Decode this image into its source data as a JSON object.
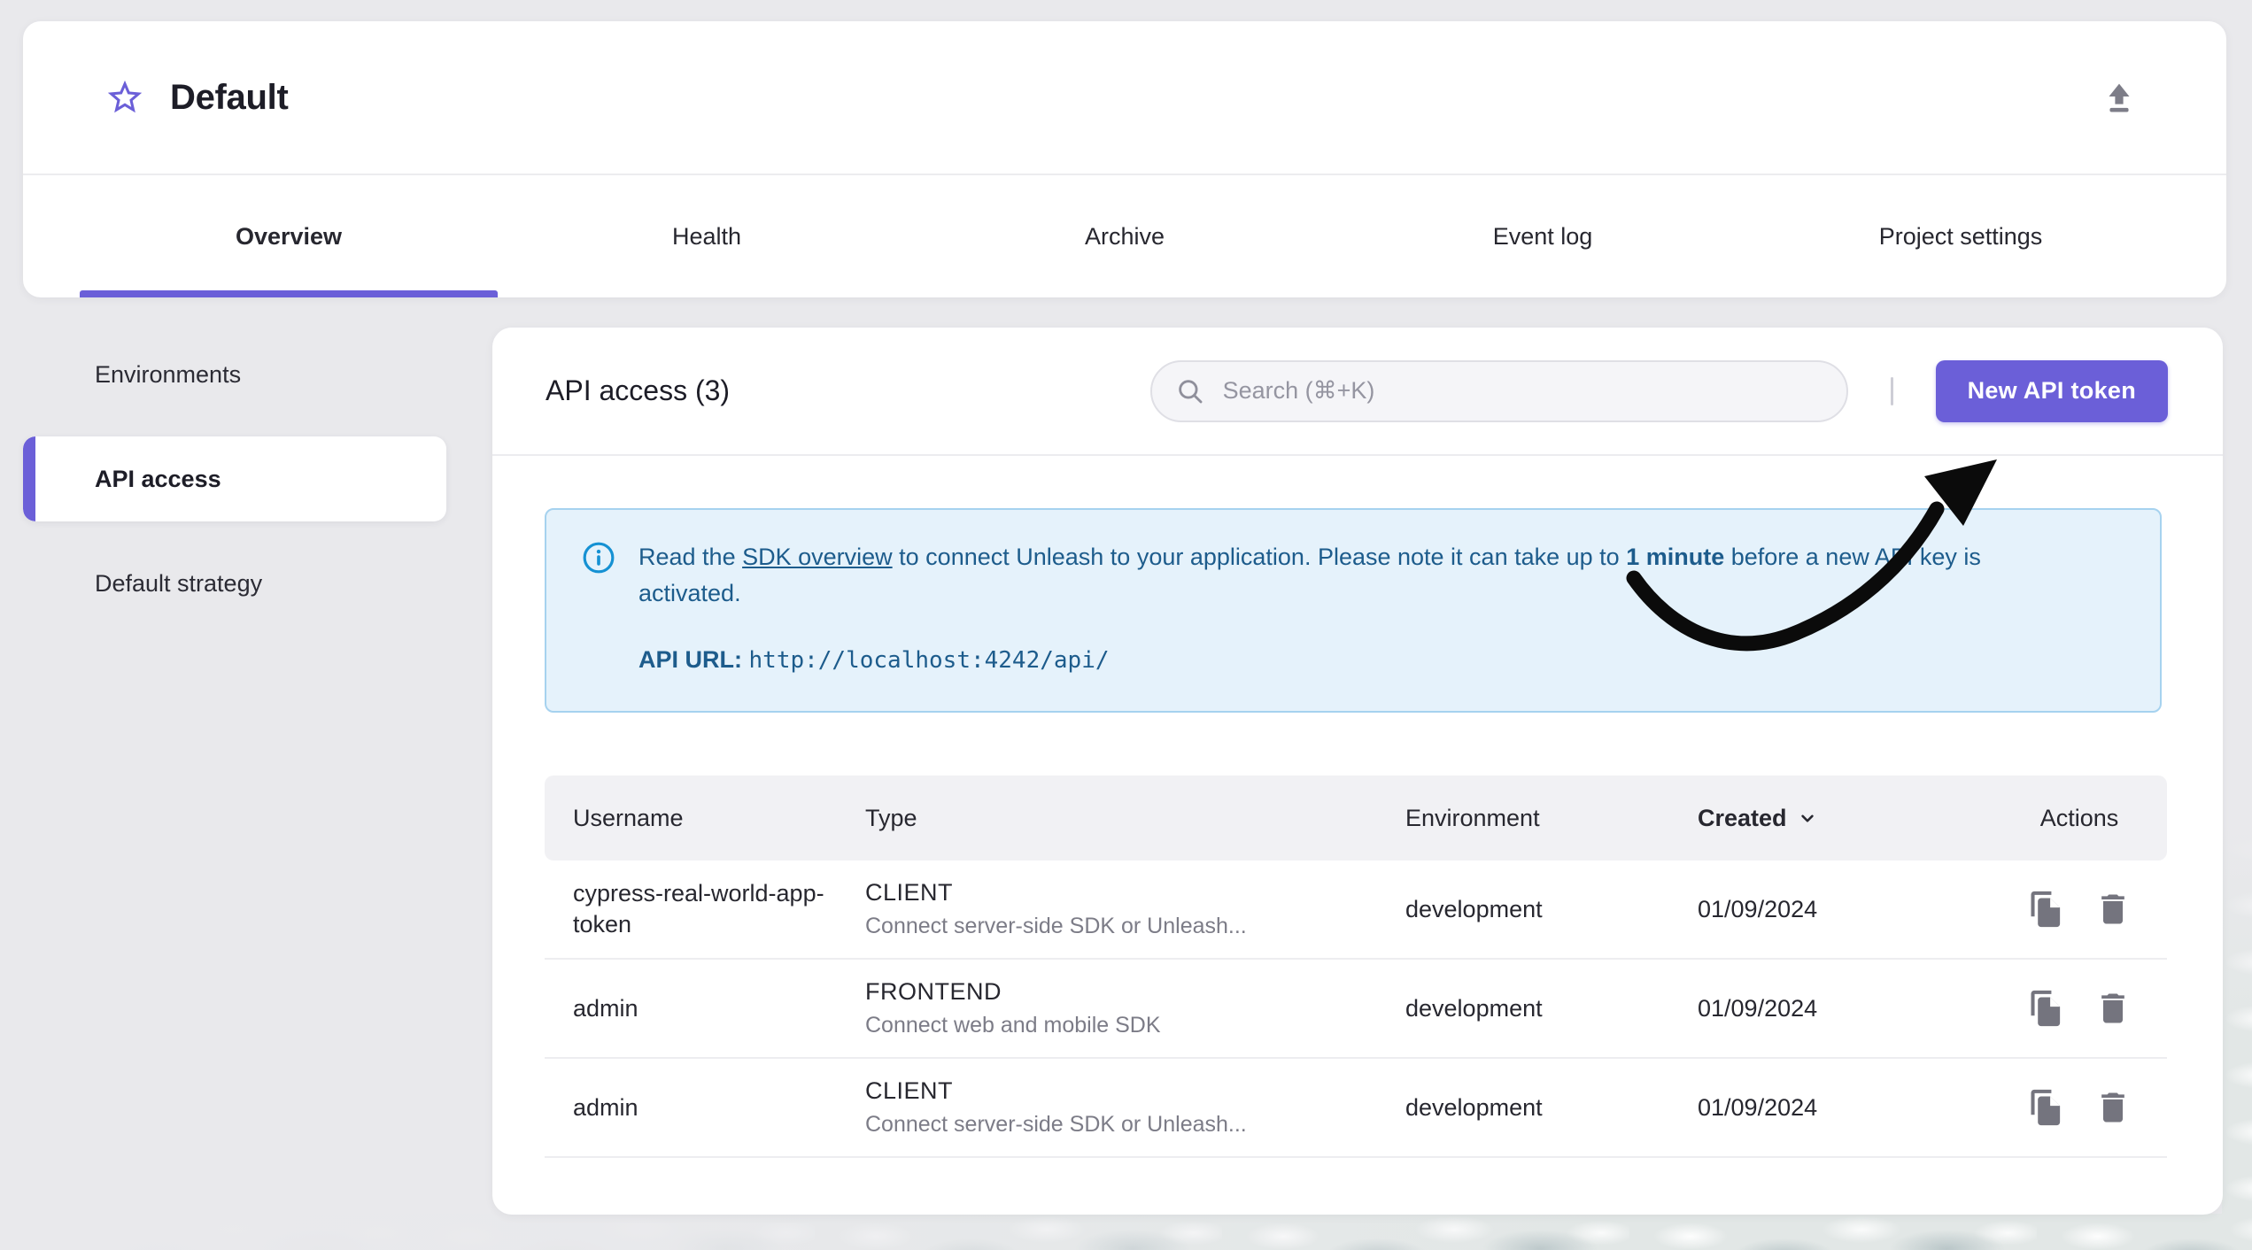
{
  "header": {
    "title": "Default",
    "favorite_icon": "star-icon",
    "export_icon": "upload-icon"
  },
  "tabs": [
    {
      "label": "Overview",
      "active": true
    },
    {
      "label": "Health",
      "active": false
    },
    {
      "label": "Archive",
      "active": false
    },
    {
      "label": "Event log",
      "active": false
    },
    {
      "label": "Project settings",
      "active": false
    }
  ],
  "sidebar": {
    "items": [
      {
        "label": "Environments",
        "active": false
      },
      {
        "label": "API access",
        "active": true
      },
      {
        "label": "Default strategy",
        "active": false
      }
    ]
  },
  "main": {
    "heading": "API access (3)",
    "search": {
      "placeholder": "Search (⌘+K)",
      "icon": "search-icon"
    },
    "new_token_button": {
      "label": "New API token"
    },
    "info_banner": {
      "icon": "info-icon",
      "text_prefix": "Read the ",
      "link_text": "SDK overview",
      "text_middle": " to connect Unleash to your application. Please note it can take up to ",
      "text_emphasis": "1 minute",
      "text_suffix": " before a new API key is activated.",
      "api_url_label": "API URL:",
      "api_url_value": "http://localhost:4242/api/"
    },
    "table": {
      "headers": {
        "username": "Username",
        "type": "Type",
        "environment": "Environment",
        "created": "Created",
        "actions": "Actions"
      },
      "sorted_by": "Created",
      "rows": [
        {
          "username": "cypress-real-world-app-token",
          "type": "CLIENT",
          "type_description": "Connect server-side SDK or Unleash...",
          "environment": "development",
          "created": "01/09/2024"
        },
        {
          "username": "admin",
          "type": "FRONTEND",
          "type_description": "Connect web and mobile SDK",
          "environment": "development",
          "created": "01/09/2024"
        },
        {
          "username": "admin",
          "type": "CLIENT",
          "type_description": "Connect server-side SDK or Unleash...",
          "environment": "development",
          "created": "01/09/2024"
        }
      ]
    }
  },
  "annotations": {
    "arrow": "hand-drawn black arrow pointing at New API token button"
  },
  "colors": {
    "primary": "#6b5fd8",
    "page_background": "#e9e9ec",
    "card_background": "#ffffff",
    "info_background": "#e5f2fb",
    "info_border": "#a6d2ef",
    "info_text": "#1d5c8c",
    "info_icon": "#1591d3",
    "table_header_background": "#f1f1f4",
    "icon_gray": "#74747e",
    "text_dark": "#1d1d27"
  }
}
